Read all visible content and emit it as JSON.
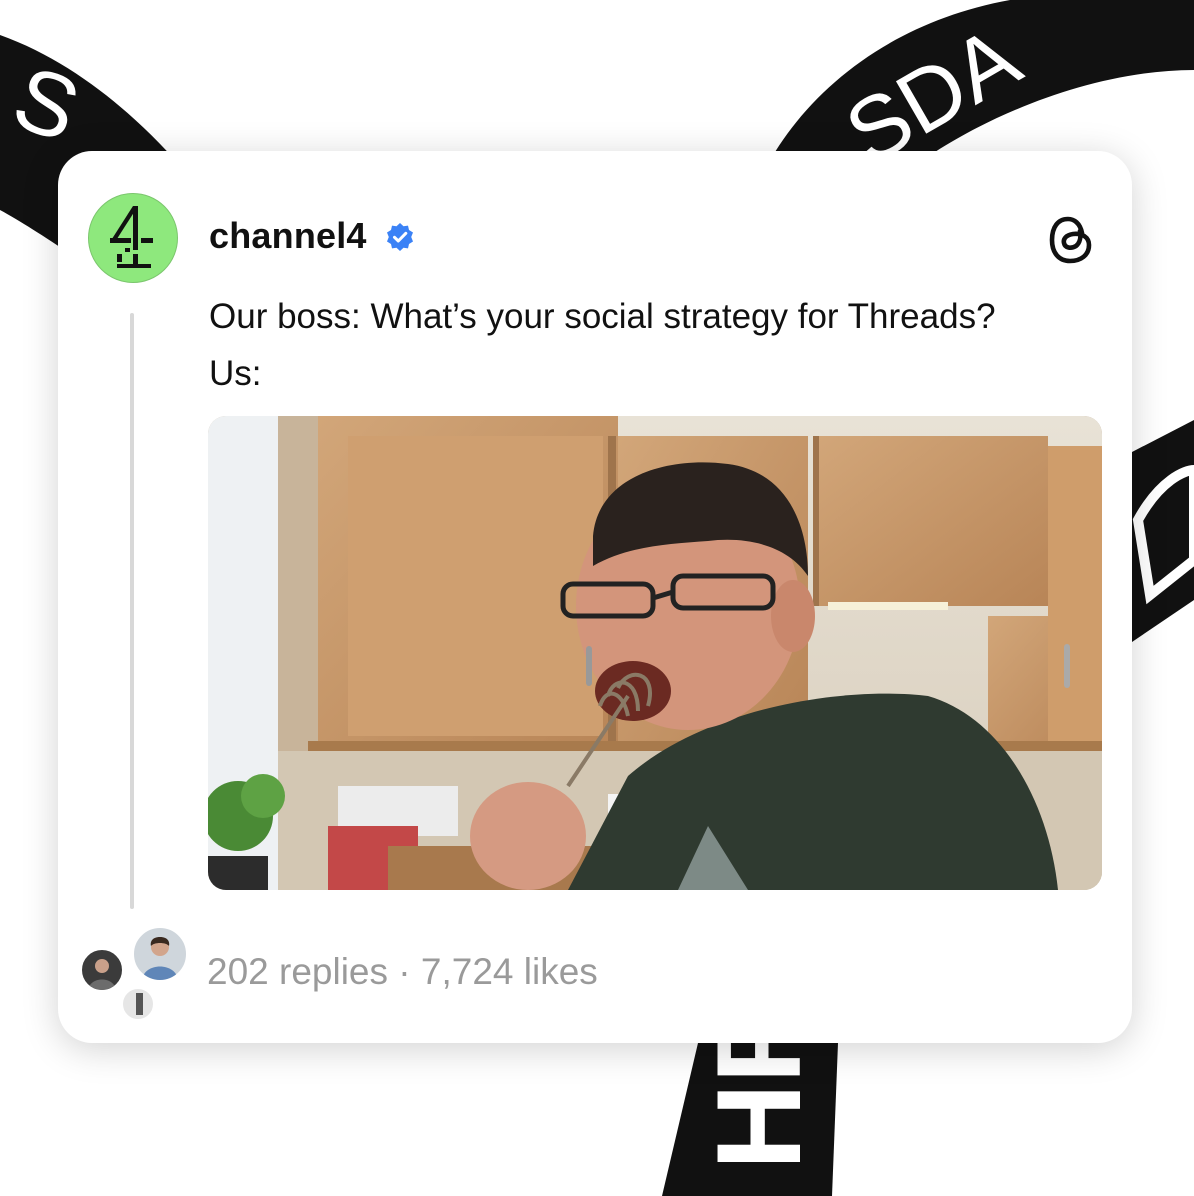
{
  "post": {
    "username": "channel4",
    "verified": true,
    "avatar_icon": "channel4-logo-icon",
    "text_line_1": "Our boss: What’s your social strategy for Threads?",
    "text_line_2": "Us:",
    "media": "video-still-man-licking-whisk",
    "replies": "202 replies",
    "separator": "·",
    "likes": "7,724 likes",
    "stats_text": "202 replies · 7,724 likes"
  },
  "colors": {
    "avatar_bg": "#8ee87d",
    "verified_blue": "#3b82f6",
    "ribbon": "#111111",
    "stats_gray": "#9a9a9a"
  }
}
